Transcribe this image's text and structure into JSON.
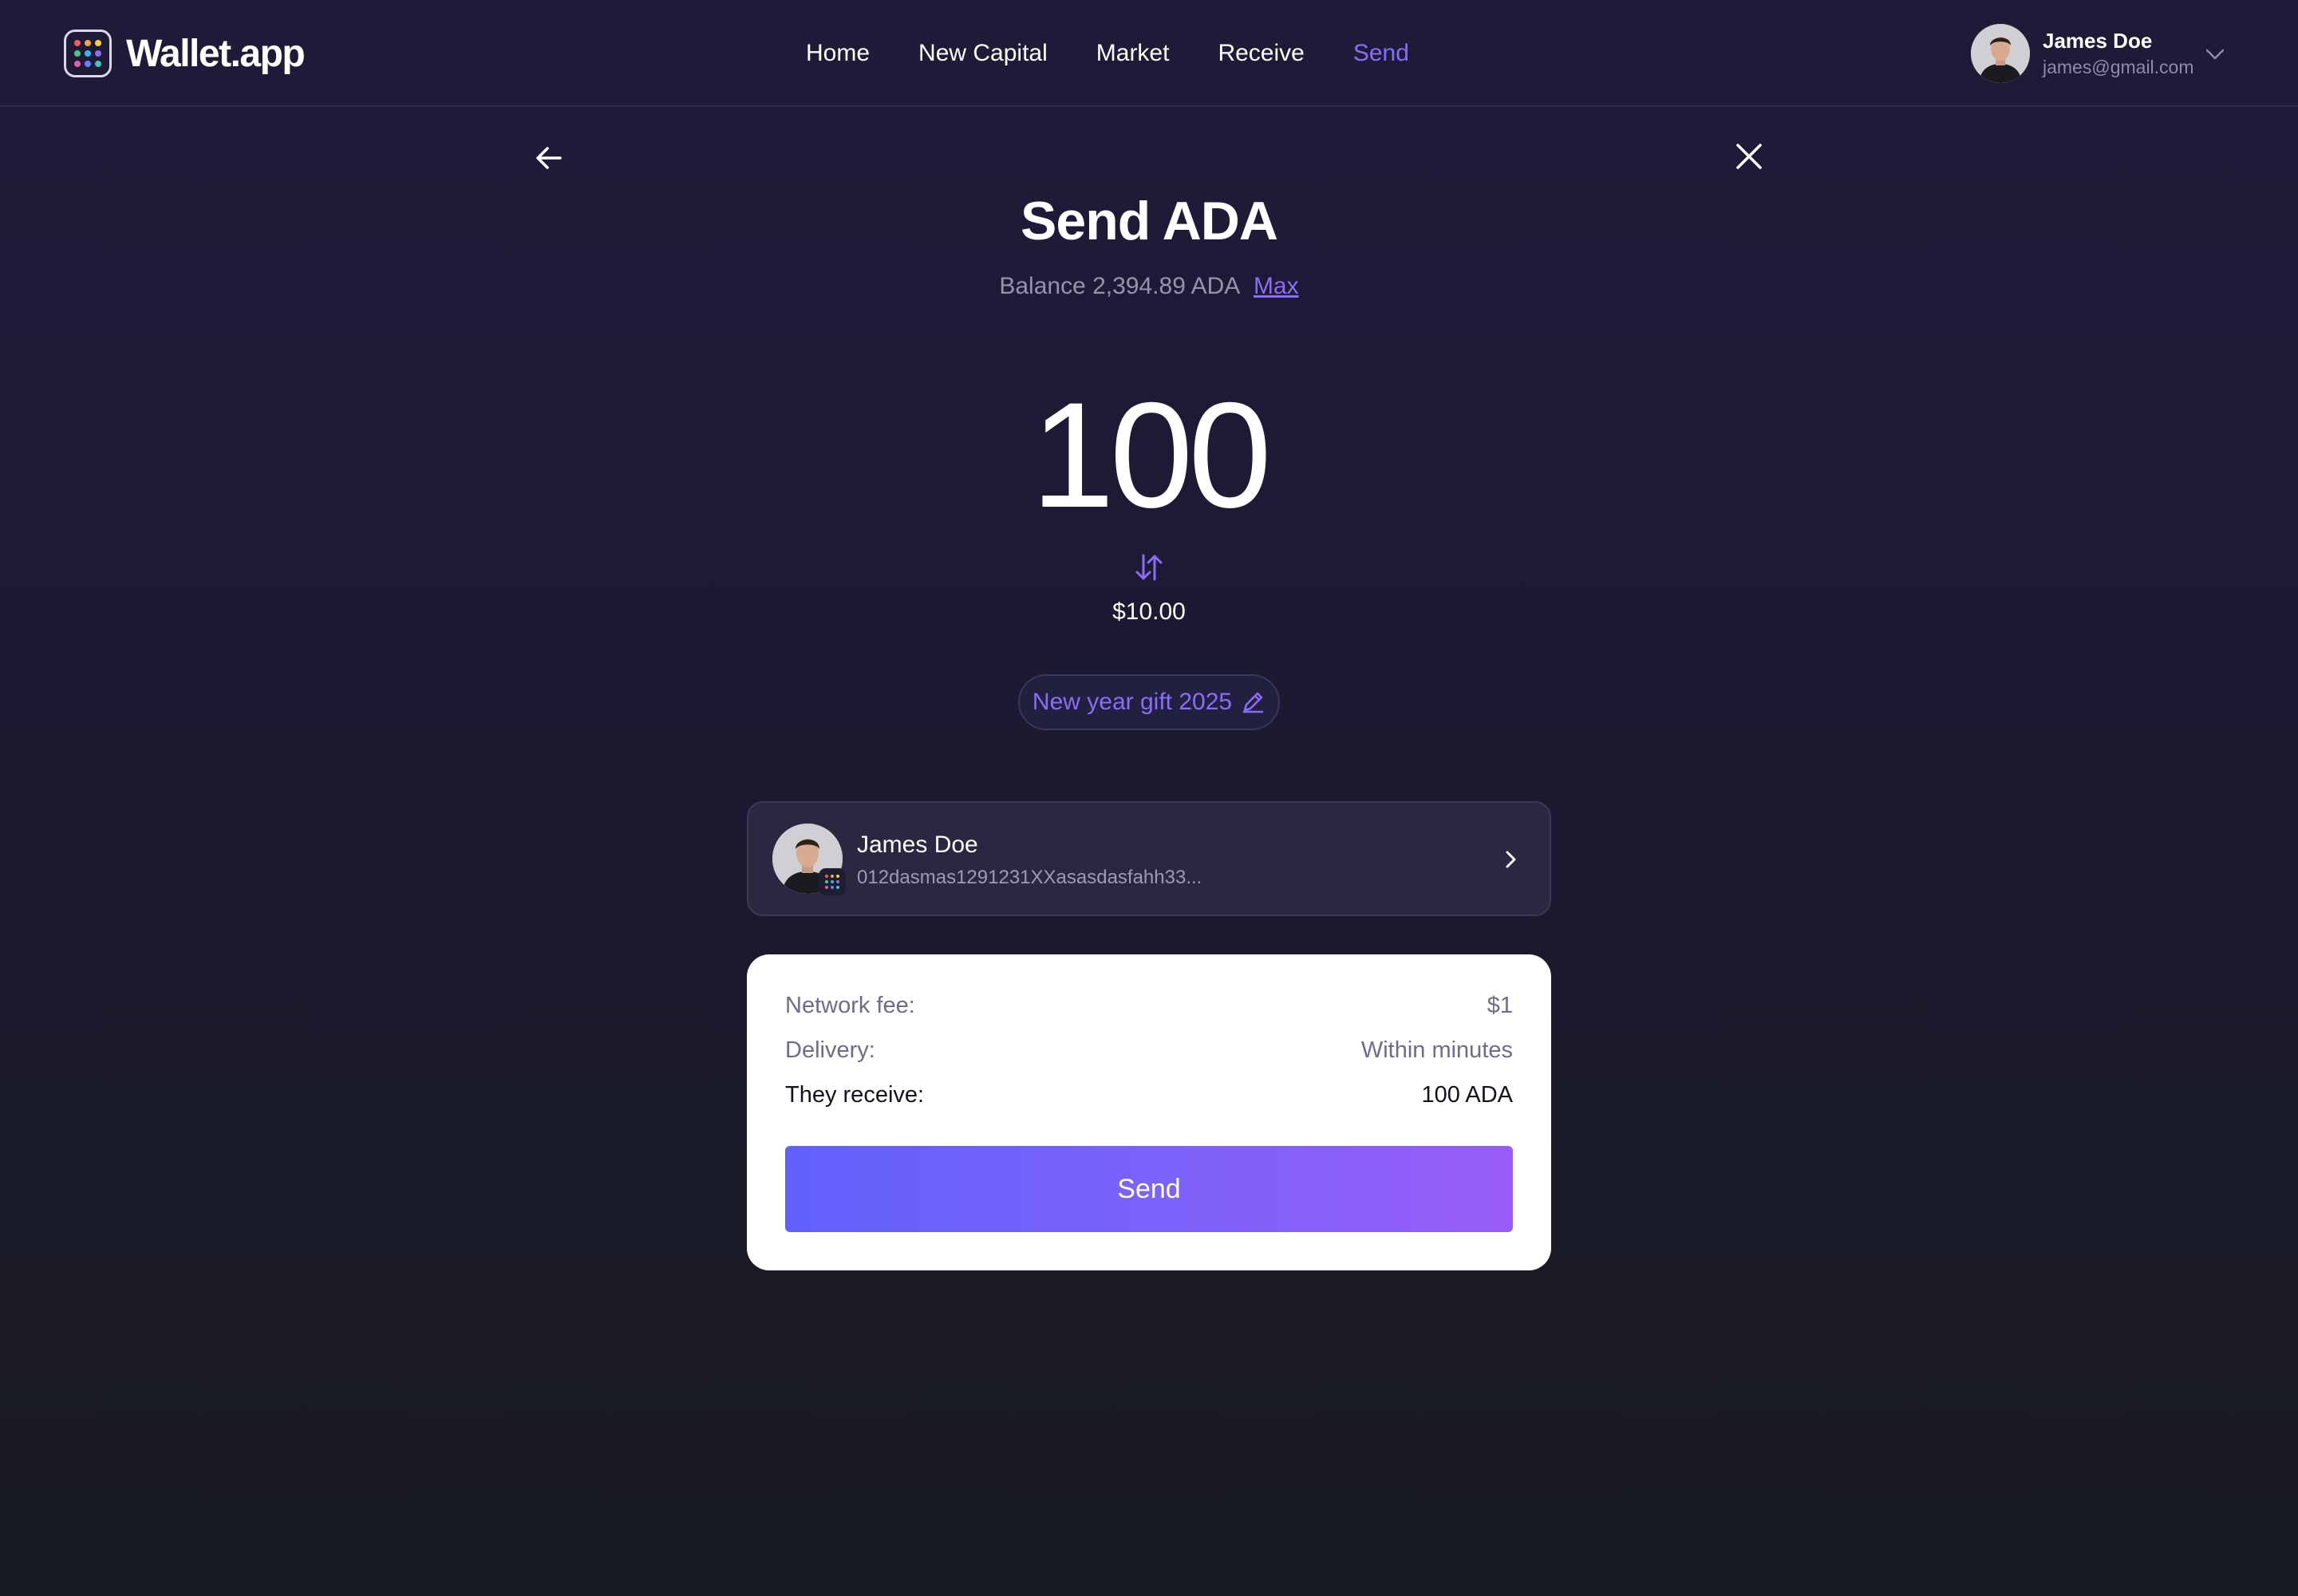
{
  "app": {
    "name": "Wallet.app",
    "logo_dot_colors": [
      "#f25c5c",
      "#f2a93b",
      "#f2d33b",
      "#4fc38a",
      "#3bb5f2",
      "#8c6cf6",
      "#e95ca9",
      "#6c7df6",
      "#44c3c3"
    ]
  },
  "nav": {
    "items": [
      {
        "label": "Home"
      },
      {
        "label": "New Capital"
      },
      {
        "label": "Market"
      },
      {
        "label": "Receive"
      },
      {
        "label": "Send"
      }
    ],
    "active": "Send"
  },
  "user": {
    "name": "James Doe",
    "email": "james@gmail.com"
  },
  "send": {
    "title": "Send ADA",
    "balance_text": "Balance 2,394.89 ADA",
    "max_label": "Max",
    "amount": "100",
    "fiat_value": "$10.00",
    "note": "New year gift 2025"
  },
  "recipient": {
    "name": "James Doe",
    "address": "012dasmas1291231XXasasdasfahh33..."
  },
  "summary": {
    "network_fee_label": "Network fee:",
    "network_fee_value": "$1",
    "delivery_label": "Delivery:",
    "delivery_value": "Within minutes",
    "receive_label": "They receive:",
    "receive_value": "100 ADA",
    "send_button": "Send"
  },
  "colors": {
    "accent": "#8c6cf6",
    "background": "#1d1b38",
    "button_gradient_start": "#6160fb",
    "button_gradient_end": "#985cf7"
  },
  "icons": {
    "back": "arrow-left-icon",
    "close": "close-icon",
    "swap": "swap-arrows-icon",
    "edit": "pencil-icon",
    "chevron_right": "chevron-right-icon",
    "chevron_down": "chevron-down-icon"
  }
}
